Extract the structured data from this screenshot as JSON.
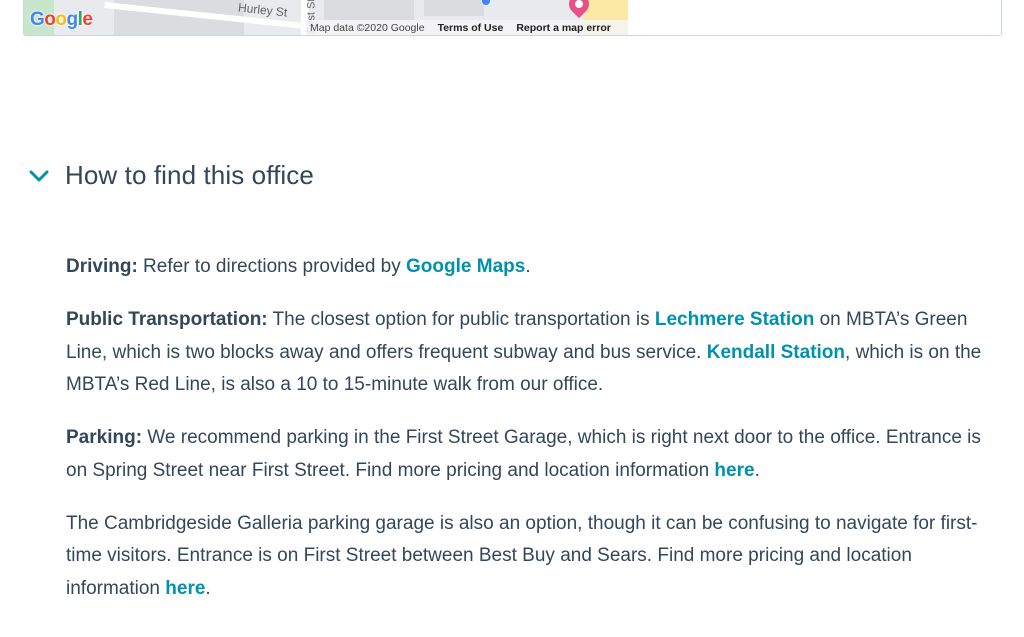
{
  "map": {
    "street_name": "Hurley St",
    "street_name_vertical": "First St",
    "logo_text": "Google",
    "attribution": {
      "map_data": "Map data ©2020 Google",
      "terms": "Terms of Use",
      "report": "Report a map error"
    }
  },
  "accordion": {
    "title": "How to find this office",
    "icon": "chevron-down-icon",
    "expanded": true
  },
  "directions": {
    "driving": {
      "label": "Driving:",
      "text_before": " Refer to directions provided by ",
      "link": "Google Maps",
      "text_after": "."
    },
    "public_transportation": {
      "label": "Public Transportation:",
      "text_1": " The closest option for public transportation is ",
      "link_1": "Lechmere Station",
      "text_2": " on MBTA’s Green Line, which is two blocks away and offers frequent subway and bus service. ",
      "link_2": "Kendall Station",
      "text_3": ", which is on the MBTA’s Red Line, is also a 10 to 15-minute walk from our office."
    },
    "parking": {
      "label": "Parking:",
      "text_before": " We recommend parking in the First Street Garage, which is right next door to the office. Entrance is on Spring Street near First Street. Find more pricing and location information ",
      "link": "here",
      "text_after": "."
    },
    "galleria": {
      "text_before": "The Cambridgeside Galleria parking garage is also an option, though it can be confusing to navigate for first-time visitors. Entrance is on First Street between Best Buy and Sears. Find more pricing and location information ",
      "link": "here",
      "text_after": "."
    }
  },
  "colors": {
    "text": "#33475b",
    "link": "#0091ae",
    "chevron": "#0091ae"
  }
}
